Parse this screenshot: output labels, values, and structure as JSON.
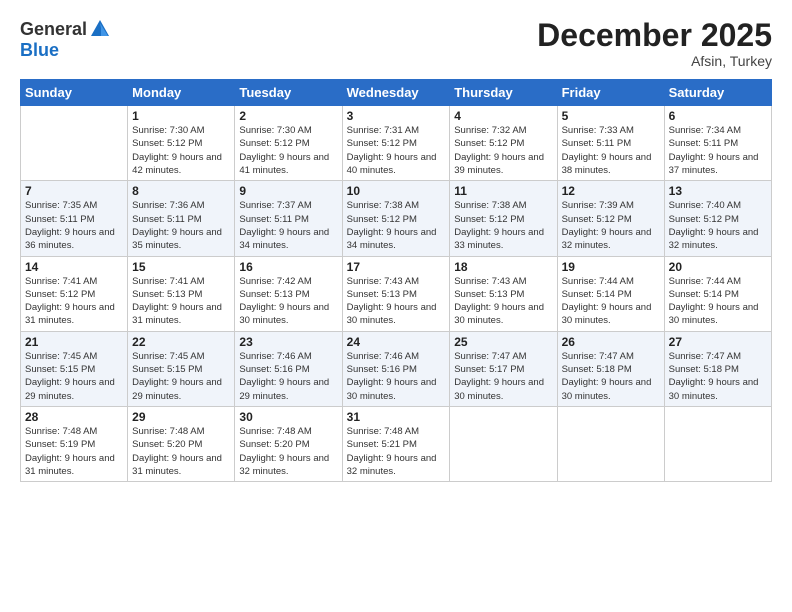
{
  "header": {
    "logo_general": "General",
    "logo_blue": "Blue",
    "month_title": "December 2025",
    "location": "Afsin, Turkey"
  },
  "weekdays": [
    "Sunday",
    "Monday",
    "Tuesday",
    "Wednesday",
    "Thursday",
    "Friday",
    "Saturday"
  ],
  "weeks": [
    [
      {
        "num": "",
        "sunrise": "",
        "sunset": "",
        "daylight": ""
      },
      {
        "num": "1",
        "sunrise": "Sunrise: 7:30 AM",
        "sunset": "Sunset: 5:12 PM",
        "daylight": "Daylight: 9 hours and 42 minutes."
      },
      {
        "num": "2",
        "sunrise": "Sunrise: 7:30 AM",
        "sunset": "Sunset: 5:12 PM",
        "daylight": "Daylight: 9 hours and 41 minutes."
      },
      {
        "num": "3",
        "sunrise": "Sunrise: 7:31 AM",
        "sunset": "Sunset: 5:12 PM",
        "daylight": "Daylight: 9 hours and 40 minutes."
      },
      {
        "num": "4",
        "sunrise": "Sunrise: 7:32 AM",
        "sunset": "Sunset: 5:12 PM",
        "daylight": "Daylight: 9 hours and 39 minutes."
      },
      {
        "num": "5",
        "sunrise": "Sunrise: 7:33 AM",
        "sunset": "Sunset: 5:11 PM",
        "daylight": "Daylight: 9 hours and 38 minutes."
      },
      {
        "num": "6",
        "sunrise": "Sunrise: 7:34 AM",
        "sunset": "Sunset: 5:11 PM",
        "daylight": "Daylight: 9 hours and 37 minutes."
      }
    ],
    [
      {
        "num": "7",
        "sunrise": "Sunrise: 7:35 AM",
        "sunset": "Sunset: 5:11 PM",
        "daylight": "Daylight: 9 hours and 36 minutes."
      },
      {
        "num": "8",
        "sunrise": "Sunrise: 7:36 AM",
        "sunset": "Sunset: 5:11 PM",
        "daylight": "Daylight: 9 hours and 35 minutes."
      },
      {
        "num": "9",
        "sunrise": "Sunrise: 7:37 AM",
        "sunset": "Sunset: 5:11 PM",
        "daylight": "Daylight: 9 hours and 34 minutes."
      },
      {
        "num": "10",
        "sunrise": "Sunrise: 7:38 AM",
        "sunset": "Sunset: 5:12 PM",
        "daylight": "Daylight: 9 hours and 34 minutes."
      },
      {
        "num": "11",
        "sunrise": "Sunrise: 7:38 AM",
        "sunset": "Sunset: 5:12 PM",
        "daylight": "Daylight: 9 hours and 33 minutes."
      },
      {
        "num": "12",
        "sunrise": "Sunrise: 7:39 AM",
        "sunset": "Sunset: 5:12 PM",
        "daylight": "Daylight: 9 hours and 32 minutes."
      },
      {
        "num": "13",
        "sunrise": "Sunrise: 7:40 AM",
        "sunset": "Sunset: 5:12 PM",
        "daylight": "Daylight: 9 hours and 32 minutes."
      }
    ],
    [
      {
        "num": "14",
        "sunrise": "Sunrise: 7:41 AM",
        "sunset": "Sunset: 5:12 PM",
        "daylight": "Daylight: 9 hours and 31 minutes."
      },
      {
        "num": "15",
        "sunrise": "Sunrise: 7:41 AM",
        "sunset": "Sunset: 5:13 PM",
        "daylight": "Daylight: 9 hours and 31 minutes."
      },
      {
        "num": "16",
        "sunrise": "Sunrise: 7:42 AM",
        "sunset": "Sunset: 5:13 PM",
        "daylight": "Daylight: 9 hours and 30 minutes."
      },
      {
        "num": "17",
        "sunrise": "Sunrise: 7:43 AM",
        "sunset": "Sunset: 5:13 PM",
        "daylight": "Daylight: 9 hours and 30 minutes."
      },
      {
        "num": "18",
        "sunrise": "Sunrise: 7:43 AM",
        "sunset": "Sunset: 5:13 PM",
        "daylight": "Daylight: 9 hours and 30 minutes."
      },
      {
        "num": "19",
        "sunrise": "Sunrise: 7:44 AM",
        "sunset": "Sunset: 5:14 PM",
        "daylight": "Daylight: 9 hours and 30 minutes."
      },
      {
        "num": "20",
        "sunrise": "Sunrise: 7:44 AM",
        "sunset": "Sunset: 5:14 PM",
        "daylight": "Daylight: 9 hours and 30 minutes."
      }
    ],
    [
      {
        "num": "21",
        "sunrise": "Sunrise: 7:45 AM",
        "sunset": "Sunset: 5:15 PM",
        "daylight": "Daylight: 9 hours and 29 minutes."
      },
      {
        "num": "22",
        "sunrise": "Sunrise: 7:45 AM",
        "sunset": "Sunset: 5:15 PM",
        "daylight": "Daylight: 9 hours and 29 minutes."
      },
      {
        "num": "23",
        "sunrise": "Sunrise: 7:46 AM",
        "sunset": "Sunset: 5:16 PM",
        "daylight": "Daylight: 9 hours and 29 minutes."
      },
      {
        "num": "24",
        "sunrise": "Sunrise: 7:46 AM",
        "sunset": "Sunset: 5:16 PM",
        "daylight": "Daylight: 9 hours and 30 minutes."
      },
      {
        "num": "25",
        "sunrise": "Sunrise: 7:47 AM",
        "sunset": "Sunset: 5:17 PM",
        "daylight": "Daylight: 9 hours and 30 minutes."
      },
      {
        "num": "26",
        "sunrise": "Sunrise: 7:47 AM",
        "sunset": "Sunset: 5:18 PM",
        "daylight": "Daylight: 9 hours and 30 minutes."
      },
      {
        "num": "27",
        "sunrise": "Sunrise: 7:47 AM",
        "sunset": "Sunset: 5:18 PM",
        "daylight": "Daylight: 9 hours and 30 minutes."
      }
    ],
    [
      {
        "num": "28",
        "sunrise": "Sunrise: 7:48 AM",
        "sunset": "Sunset: 5:19 PM",
        "daylight": "Daylight: 9 hours and 31 minutes."
      },
      {
        "num": "29",
        "sunrise": "Sunrise: 7:48 AM",
        "sunset": "Sunset: 5:20 PM",
        "daylight": "Daylight: 9 hours and 31 minutes."
      },
      {
        "num": "30",
        "sunrise": "Sunrise: 7:48 AM",
        "sunset": "Sunset: 5:20 PM",
        "daylight": "Daylight: 9 hours and 32 minutes."
      },
      {
        "num": "31",
        "sunrise": "Sunrise: 7:48 AM",
        "sunset": "Sunset: 5:21 PM",
        "daylight": "Daylight: 9 hours and 32 minutes."
      },
      {
        "num": "",
        "sunrise": "",
        "sunset": "",
        "daylight": ""
      },
      {
        "num": "",
        "sunrise": "",
        "sunset": "",
        "daylight": ""
      },
      {
        "num": "",
        "sunrise": "",
        "sunset": "",
        "daylight": ""
      }
    ]
  ]
}
